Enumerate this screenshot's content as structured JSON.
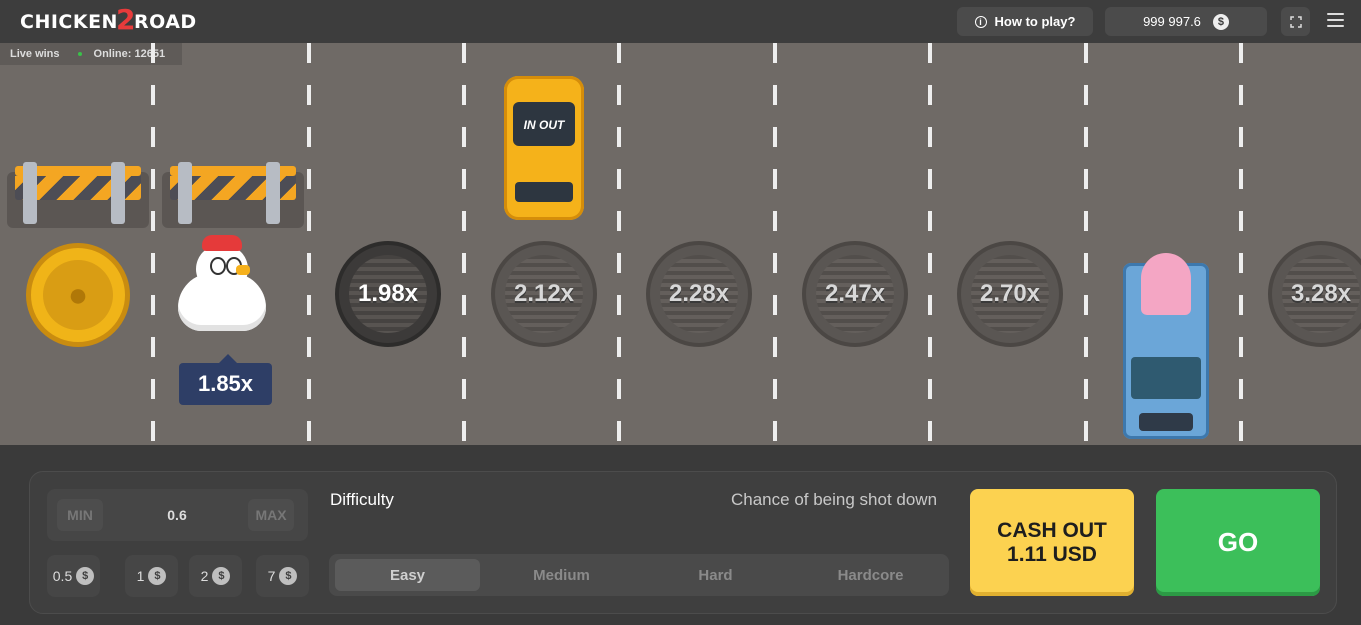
{
  "header": {
    "logo_prefix": "CHICKEN",
    "logo_mid": "2",
    "logo_suffix": "ROAD",
    "how_to_play": "How to play?",
    "balance": "999 997.6",
    "currency_icon": "$",
    "icons": [
      "info-icon",
      "dollar-coin-icon",
      "fullscreen-icon",
      "menu-icon"
    ]
  },
  "live": {
    "label": "Live wins",
    "online": "Online: 12651"
  },
  "road": {
    "current_multiplier": "1.85x",
    "taxi_label": "IN OUT",
    "multipliers": [
      "1.98x",
      "2.12x",
      "2.28x",
      "2.47x",
      "2.70x",
      "3.28x"
    ]
  },
  "bet": {
    "min_label": "MIN",
    "max_label": "MAX",
    "amount": "0.6",
    "chips": [
      "0.5",
      "1",
      "2",
      "7"
    ],
    "chip_currency": "$"
  },
  "difficulty": {
    "label": "Difficulty",
    "chance_label": "Chance of being shot down",
    "options": [
      "Easy",
      "Medium",
      "Hard",
      "Hardcore"
    ],
    "selected": "Easy"
  },
  "actions": {
    "cashout_line1": "CASH OUT",
    "cashout_line2": "1.11 USD",
    "go": "GO"
  },
  "colors": {
    "road": "#6f6a66",
    "cashout": "#fcd250",
    "go": "#3cbf5a",
    "multiplier_tag": "#2e3e66"
  }
}
